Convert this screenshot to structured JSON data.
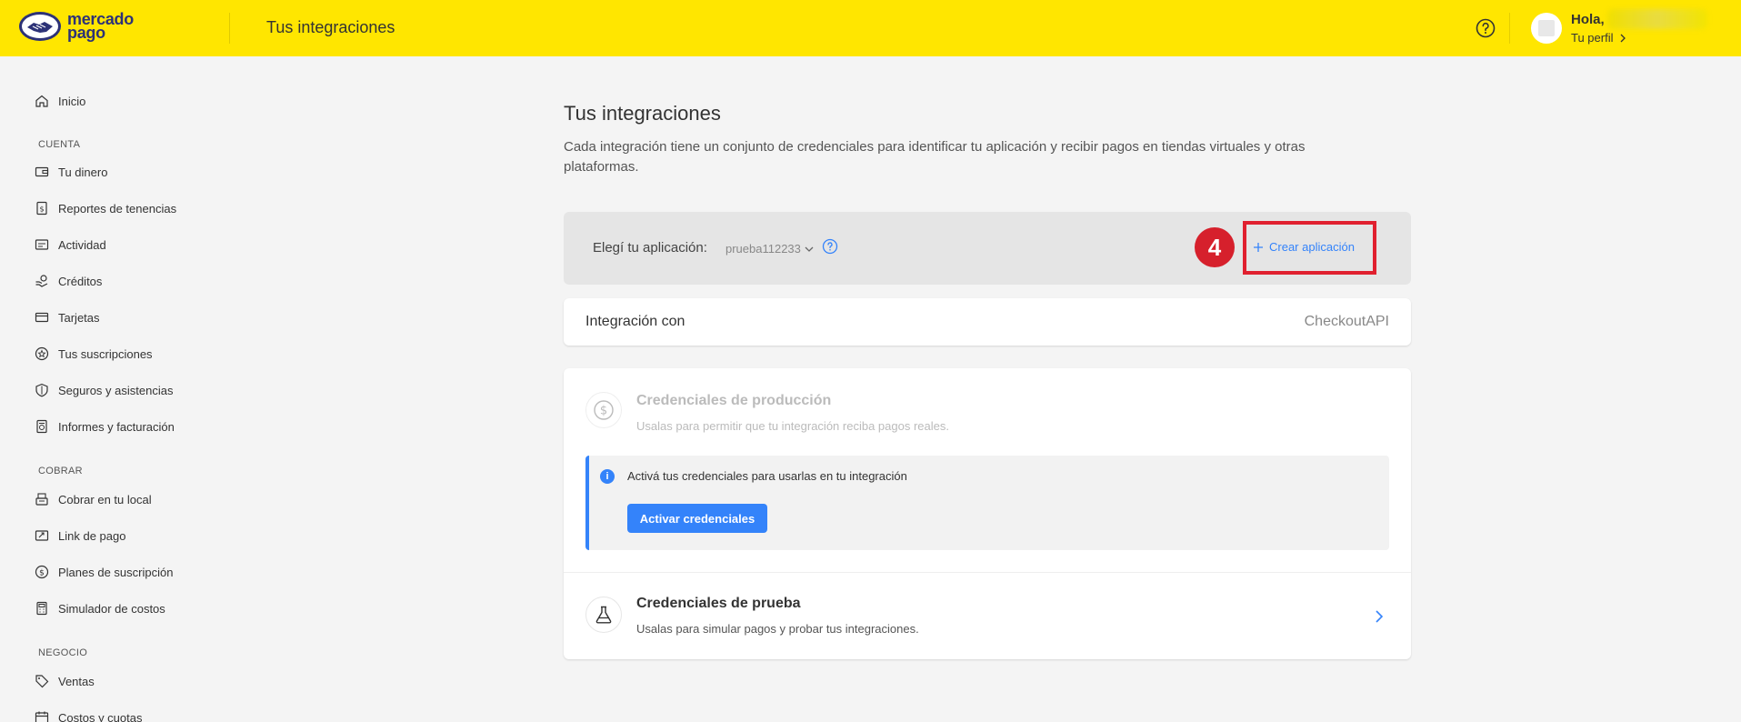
{
  "header": {
    "brand_line1": "mercado",
    "brand_line2": "pago",
    "title": "Tus integraciones",
    "greeting": "Hola,",
    "profile_link": "Tu perfil"
  },
  "sidebar": {
    "home": "Inicio",
    "sections": {
      "cuenta": "CUENTA",
      "cobrar": "COBRAR",
      "negocio": "NEGOCIO"
    },
    "items": [
      "Tu dinero",
      "Reportes de tenencias",
      "Actividad",
      "Créditos",
      "Tarjetas",
      "Tus suscripciones",
      "Seguros y asistencias",
      "Informes y facturación",
      "Cobrar en tu local",
      "Link de pago",
      "Planes de suscripción",
      "Simulador de costos",
      "Ventas",
      "Costos y cuotas"
    ]
  },
  "main": {
    "title": "Tus integraciones",
    "description": "Cada integración tiene un conjunto de credenciales para identificar tu aplicación y recibir pagos en tiendas virtuales y otras plataformas.",
    "app_selector": {
      "label": "Elegí tu aplicación:",
      "selected": "prueba112233",
      "step_number": "4",
      "create_label": "Crear aplicación"
    },
    "integration": {
      "label": "Integración con",
      "value": "CheckoutAPI"
    },
    "production": {
      "title": "Credenciales de producción",
      "subtitle": "Usalas para permitir que tu integración reciba pagos reales.",
      "notice": "Activá tus credenciales para usarlas en tu integración",
      "notice_icon": "i",
      "activate_button": "Activar credenciales"
    },
    "test": {
      "title": "Credenciales de prueba",
      "subtitle": "Usalas para simular pagos y probar tus integraciones."
    }
  },
  "colors": {
    "header_bg": "#ffe600",
    "accent_blue": "#3483fa",
    "highlight_red": "#e0202f"
  }
}
